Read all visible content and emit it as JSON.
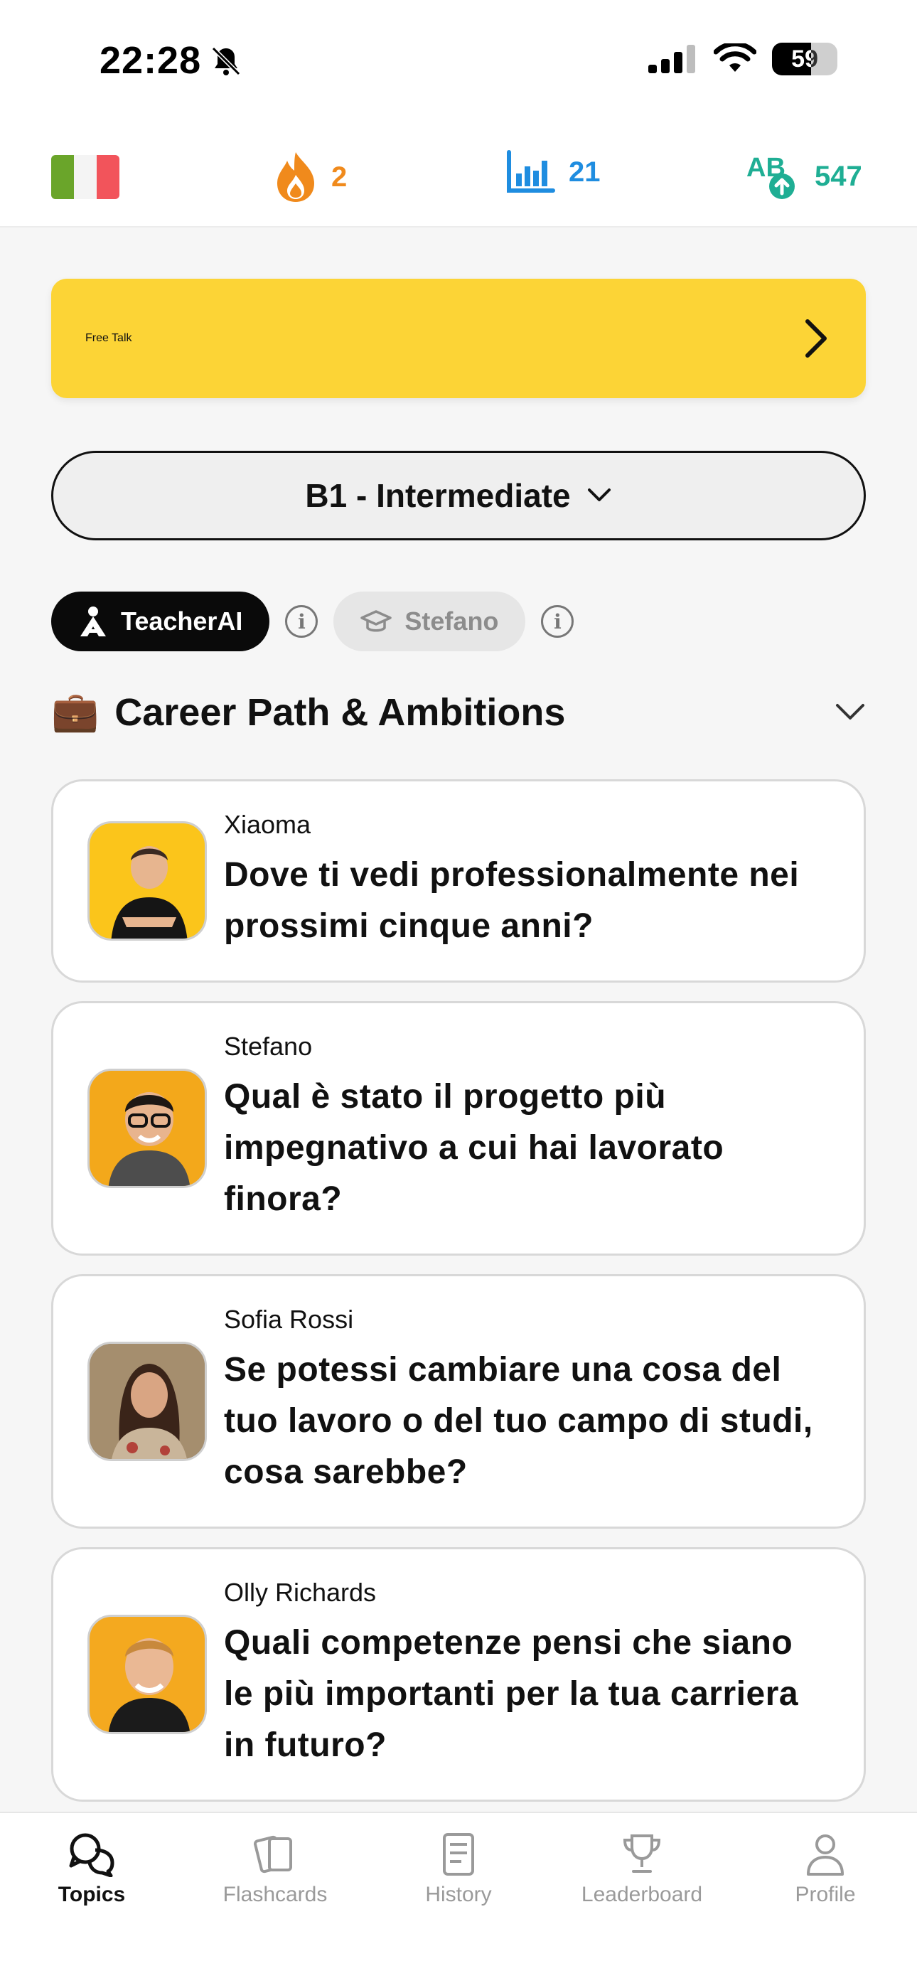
{
  "status_bar": {
    "time": "22:28",
    "battery": "59"
  },
  "top_stats": {
    "flag": "italy-flag",
    "streak": "2",
    "level_count": "21",
    "xp": "547"
  },
  "free_talk": {
    "label": "Free Talk"
  },
  "level_select": {
    "label": "B1 - Intermediate"
  },
  "tutors": {
    "teacher_ai": "TeacherAI",
    "stefano": "Stefano"
  },
  "section": {
    "emoji": "💼",
    "title": "Career Path & Ambitions"
  },
  "cards": [
    {
      "author": "Xiaoma",
      "question": "Dove ti vedi professionalmente nei prossimi cinque anni?"
    },
    {
      "author": "Stefano",
      "question": "Qual è stato il progetto più impegnativo a cui hai lavorato finora?"
    },
    {
      "author": "Sofia Rossi",
      "question": "Se potessi cambiare una cosa del tuo lavoro o del tuo campo di studi, cosa sarebbe?"
    },
    {
      "author": "Olly Richards",
      "question": "Quali competenze pensi che siano le più importanti per la tua carriera in futuro?"
    }
  ],
  "tabs": [
    {
      "label": "Topics",
      "icon": "chat-bubbles-icon"
    },
    {
      "label": "Flashcards",
      "icon": "cards-icon"
    },
    {
      "label": "History",
      "icon": "document-icon"
    },
    {
      "label": "Leaderboard",
      "icon": "trophy-icon"
    },
    {
      "label": "Profile",
      "icon": "person-icon"
    }
  ],
  "colors": {
    "accent_yellow": "#fcd436",
    "streak_orange": "#f08a1c",
    "level_blue": "#1f8de0",
    "xp_green": "#1fae94"
  }
}
